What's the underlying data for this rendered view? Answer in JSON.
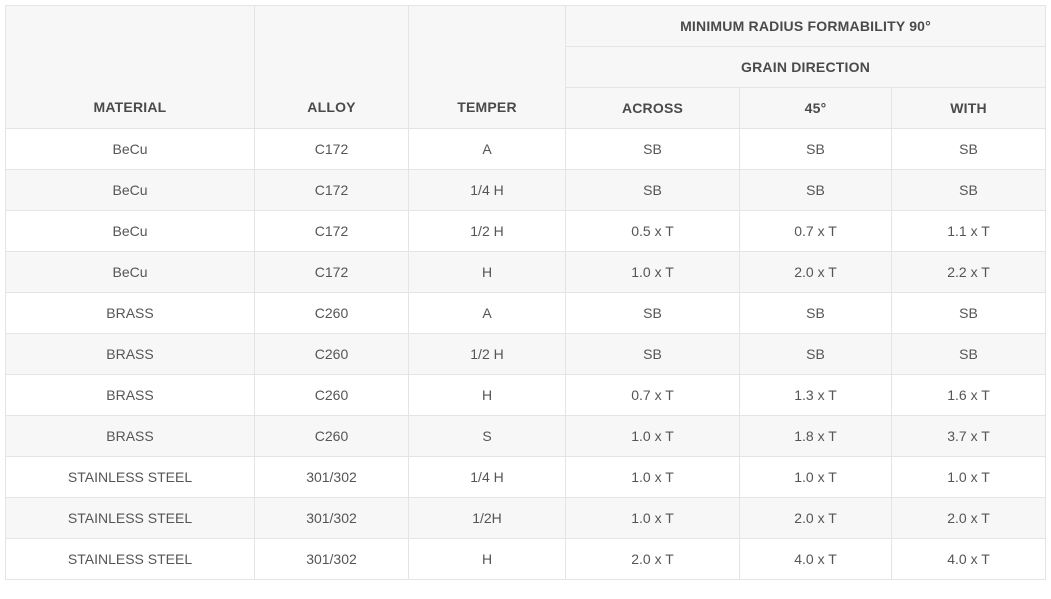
{
  "table": {
    "group_header": "MINIMUM RADIUS FORMABILITY 90°",
    "sub_header": "GRAIN DIRECTION",
    "columns": {
      "material": "MATERIAL",
      "alloy": "ALLOY",
      "temper": "TEMPER",
      "across": "ACROSS",
      "deg45": "45°",
      "with": "WITH"
    },
    "rows": [
      {
        "material": "BeCu",
        "alloy": "C172",
        "temper": "A",
        "across": "SB",
        "deg45": "SB",
        "with": "SB"
      },
      {
        "material": "BeCu",
        "alloy": "C172",
        "temper": "1/4 H",
        "across": "SB",
        "deg45": "SB",
        "with": "SB"
      },
      {
        "material": "BeCu",
        "alloy": "C172",
        "temper": "1/2 H",
        "across": "0.5 x T",
        "deg45": "0.7 x T",
        "with": "1.1 x T"
      },
      {
        "material": "BeCu",
        "alloy": "C172",
        "temper": "H",
        "across": "1.0 x T",
        "deg45": "2.0 x T",
        "with": "2.2 x T"
      },
      {
        "material": "BRASS",
        "alloy": "C260",
        "temper": "A",
        "across": "SB",
        "deg45": "SB",
        "with": "SB"
      },
      {
        "material": "BRASS",
        "alloy": "C260",
        "temper": "1/2 H",
        "across": "SB",
        "deg45": "SB",
        "with": "SB"
      },
      {
        "material": "BRASS",
        "alloy": "C260",
        "temper": "H",
        "across": "0.7 x T",
        "deg45": "1.3 x T",
        "with": "1.6 x T"
      },
      {
        "material": "BRASS",
        "alloy": "C260",
        "temper": "S",
        "across": "1.0 x T",
        "deg45": "1.8 x T",
        "with": "3.7 x T"
      },
      {
        "material": "STAINLESS STEEL",
        "alloy": "301/302",
        "temper": "1/4 H",
        "across": "1.0 x T",
        "deg45": "1.0 x T",
        "with": "1.0 x T"
      },
      {
        "material": "STAINLESS STEEL",
        "alloy": "301/302",
        "temper": "1/2H",
        "across": "1.0 x T",
        "deg45": "2.0 x T",
        "with": "2.0 x T"
      },
      {
        "material": "STAINLESS STEEL",
        "alloy": "301/302",
        "temper": "H",
        "across": "2.0 x T",
        "deg45": "4.0 x T",
        "with": "4.0 x T"
      }
    ]
  }
}
